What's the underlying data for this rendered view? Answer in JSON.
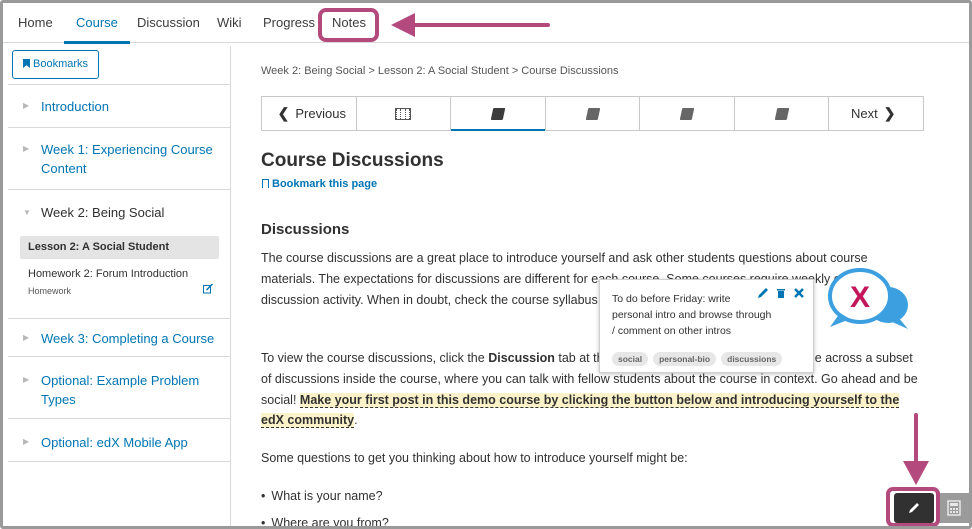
{
  "nav": {
    "tabs": [
      "Home",
      "Course",
      "Discussion",
      "Wiki",
      "Progress",
      "Notes"
    ],
    "active": "Course"
  },
  "sidebar": {
    "bookmarks_label": "Bookmarks",
    "sections": [
      {
        "title": "Introduction"
      },
      {
        "title": "Week 1: Experiencing Course Content"
      },
      {
        "title": "Week 2: Being Social"
      },
      {
        "title": "Week 3: Completing a Course"
      },
      {
        "title": "Optional: Example Problem Types"
      },
      {
        "title": "Optional: edX Mobile App"
      }
    ],
    "active_lesson": "Lesson 2: A Social Student",
    "homework_title": "Homework 2: Forum Introduction",
    "homework_sub": "Homework"
  },
  "main": {
    "breadcrumb": "Week 2: Being Social > Lesson 2: A Social Student > Course Discussions",
    "seq_prev": "Previous",
    "seq_next": "Next",
    "page_title": "Course Discussions",
    "bookmark_page": "Bookmark this page",
    "heading": "Discussions",
    "p1": "The course discussions are a great place to introduce yourself and ask other students questions about course materials. The expectations for discussions are different for each course. Some courses require weekly or daily discussion activity. When in doubt, check the course syllabus or expectations for guidance.",
    "p2_a": "To view the course discussions, click the ",
    "p2_bold": "Discussion",
    "p2_b": " tab at the top of this page. You might also come across a subset of discussions inside the course, where you can talk with fellow students about the course in context. Go ahead and be social! ",
    "p2_hl": "Make your first post in this demo course by clicking the button below and introducing yourself to the edX community",
    "p2_end": ".",
    "p3": "Some questions to get you thinking about how to introduce yourself might be:",
    "bullets": [
      "What is your name?",
      "Where are you from?"
    ]
  },
  "popup": {
    "text": "To do before Friday: write personal intro and browse through / comment on other intros",
    "tags": [
      "social",
      "personal-bio",
      "discussions"
    ]
  },
  "colors": {
    "accent": "#0075b4",
    "highlight_border": "#b4497e",
    "note_highlight": "#fbf2c9",
    "logo_pink": "#c2185b",
    "logo_blue": "#3b9fe0"
  }
}
